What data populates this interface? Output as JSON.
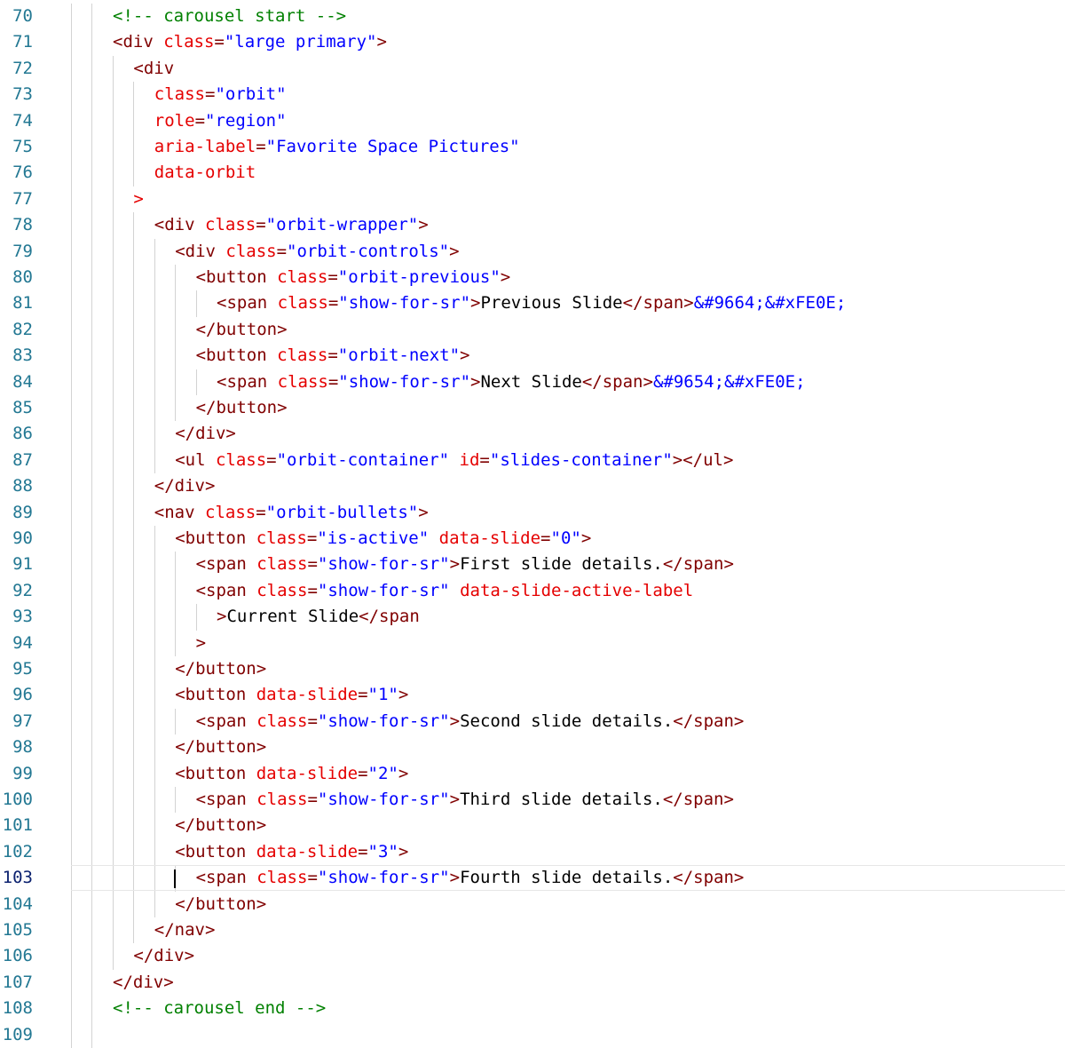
{
  "editor": {
    "language": "html",
    "current_line": 103,
    "colors": {
      "line_number": "#237893",
      "line_number_active": "#0b216f",
      "comment": "#008000",
      "tag": "#800000",
      "attribute": "#e50000",
      "string": "#0000ff",
      "text": "#000000",
      "indent_guide": "#d3d3d3"
    },
    "lines": [
      {
        "num": "70",
        "indent": 0,
        "tokens": [
          [
            "comment",
            "<!-- carousel start -->"
          ]
        ]
      },
      {
        "num": "71",
        "indent": 0,
        "tokens": [
          [
            "tag",
            "<div "
          ],
          [
            "attr",
            "class"
          ],
          [
            "tag",
            "="
          ],
          [
            "str",
            "\"large primary\""
          ],
          [
            "tag",
            ">"
          ]
        ]
      },
      {
        "num": "72",
        "indent": 1,
        "tokens": [
          [
            "tag",
            "<div"
          ]
        ]
      },
      {
        "num": "73",
        "indent": 2,
        "tokens": [
          [
            "attr",
            "class"
          ],
          [
            "tag",
            "="
          ],
          [
            "str",
            "\"orbit\""
          ]
        ]
      },
      {
        "num": "74",
        "indent": 2,
        "tokens": [
          [
            "attr",
            "role"
          ],
          [
            "tag",
            "="
          ],
          [
            "str",
            "\"region\""
          ]
        ]
      },
      {
        "num": "75",
        "indent": 2,
        "tokens": [
          [
            "attr",
            "aria-label"
          ],
          [
            "tag",
            "="
          ],
          [
            "str",
            "\"Favorite Space Pictures\""
          ]
        ]
      },
      {
        "num": "76",
        "indent": 2,
        "tokens": [
          [
            "attr",
            "data-orbit"
          ]
        ]
      },
      {
        "num": "77",
        "indent": 1,
        "tokens": [
          [
            "attr",
            ">"
          ]
        ]
      },
      {
        "num": "78",
        "indent": 2,
        "tokens": [
          [
            "tag",
            "<div "
          ],
          [
            "attr",
            "class"
          ],
          [
            "tag",
            "="
          ],
          [
            "str",
            "\"orbit-wrapper\""
          ],
          [
            "tag",
            ">"
          ]
        ]
      },
      {
        "num": "79",
        "indent": 3,
        "tokens": [
          [
            "tag",
            "<div "
          ],
          [
            "attr",
            "class"
          ],
          [
            "tag",
            "="
          ],
          [
            "str",
            "\"orbit-controls\""
          ],
          [
            "tag",
            ">"
          ]
        ]
      },
      {
        "num": "80",
        "indent": 4,
        "tokens": [
          [
            "tag",
            "<button "
          ],
          [
            "attr",
            "class"
          ],
          [
            "tag",
            "="
          ],
          [
            "str",
            "\"orbit-previous\""
          ],
          [
            "tag",
            ">"
          ]
        ]
      },
      {
        "num": "81",
        "indent": 5,
        "tokens": [
          [
            "tag",
            "<span "
          ],
          [
            "attr",
            "class"
          ],
          [
            "tag",
            "="
          ],
          [
            "str",
            "\"show-for-sr\""
          ],
          [
            "tag",
            ">"
          ],
          [
            "text",
            "Previous Slide"
          ],
          [
            "tag",
            "</span>"
          ],
          [
            "ent",
            "&#9664;&#xFE0E;"
          ]
        ]
      },
      {
        "num": "82",
        "indent": 4,
        "tokens": [
          [
            "tag",
            "</button>"
          ]
        ]
      },
      {
        "num": "83",
        "indent": 4,
        "tokens": [
          [
            "tag",
            "<button "
          ],
          [
            "attr",
            "class"
          ],
          [
            "tag",
            "="
          ],
          [
            "str",
            "\"orbit-next\""
          ],
          [
            "tag",
            ">"
          ]
        ]
      },
      {
        "num": "84",
        "indent": 5,
        "tokens": [
          [
            "tag",
            "<span "
          ],
          [
            "attr",
            "class"
          ],
          [
            "tag",
            "="
          ],
          [
            "str",
            "\"show-for-sr\""
          ],
          [
            "tag",
            ">"
          ],
          [
            "text",
            "Next Slide"
          ],
          [
            "tag",
            "</span>"
          ],
          [
            "ent",
            "&#9654;&#xFE0E;"
          ]
        ]
      },
      {
        "num": "85",
        "indent": 4,
        "tokens": [
          [
            "tag",
            "</button>"
          ]
        ]
      },
      {
        "num": "86",
        "indent": 3,
        "tokens": [
          [
            "tag",
            "</div>"
          ]
        ]
      },
      {
        "num": "87",
        "indent": 3,
        "tokens": [
          [
            "tag",
            "<ul "
          ],
          [
            "attr",
            "class"
          ],
          [
            "tag",
            "="
          ],
          [
            "str",
            "\"orbit-container\""
          ],
          [
            "text",
            " "
          ],
          [
            "attr",
            "id"
          ],
          [
            "tag",
            "="
          ],
          [
            "str",
            "\"slides-container\""
          ],
          [
            "tag",
            "></ul>"
          ]
        ]
      },
      {
        "num": "88",
        "indent": 2,
        "tokens": [
          [
            "tag",
            "</div>"
          ]
        ]
      },
      {
        "num": "89",
        "indent": 2,
        "tokens": [
          [
            "tag",
            "<nav "
          ],
          [
            "attr",
            "class"
          ],
          [
            "tag",
            "="
          ],
          [
            "str",
            "\"orbit-bullets\""
          ],
          [
            "tag",
            ">"
          ]
        ]
      },
      {
        "num": "90",
        "indent": 3,
        "tokens": [
          [
            "tag",
            "<button "
          ],
          [
            "attr",
            "class"
          ],
          [
            "tag",
            "="
          ],
          [
            "str",
            "\"is-active\""
          ],
          [
            "text",
            " "
          ],
          [
            "attr",
            "data-slide"
          ],
          [
            "tag",
            "="
          ],
          [
            "str",
            "\"0\""
          ],
          [
            "tag",
            ">"
          ]
        ]
      },
      {
        "num": "91",
        "indent": 4,
        "tokens": [
          [
            "tag",
            "<span "
          ],
          [
            "attr",
            "class"
          ],
          [
            "tag",
            "="
          ],
          [
            "str",
            "\"show-for-sr\""
          ],
          [
            "tag",
            ">"
          ],
          [
            "text",
            "First slide details."
          ],
          [
            "tag",
            "</span>"
          ]
        ]
      },
      {
        "num": "92",
        "indent": 4,
        "tokens": [
          [
            "tag",
            "<span "
          ],
          [
            "attr",
            "class"
          ],
          [
            "tag",
            "="
          ],
          [
            "str",
            "\"show-for-sr\""
          ],
          [
            "text",
            " "
          ],
          [
            "attr",
            "data-slide-active-label"
          ]
        ]
      },
      {
        "num": "93",
        "indent": 5,
        "tokens": [
          [
            "tag",
            ">"
          ],
          [
            "text",
            "Current Slide"
          ],
          [
            "tag",
            "</span"
          ]
        ]
      },
      {
        "num": "94",
        "indent": 4,
        "tokens": [
          [
            "tag",
            ">"
          ]
        ]
      },
      {
        "num": "95",
        "indent": 3,
        "tokens": [
          [
            "tag",
            "</button>"
          ]
        ]
      },
      {
        "num": "96",
        "indent": 3,
        "tokens": [
          [
            "tag",
            "<button "
          ],
          [
            "attr",
            "data-slide"
          ],
          [
            "tag",
            "="
          ],
          [
            "str",
            "\"1\""
          ],
          [
            "tag",
            ">"
          ]
        ]
      },
      {
        "num": "97",
        "indent": 4,
        "tokens": [
          [
            "tag",
            "<span "
          ],
          [
            "attr",
            "class"
          ],
          [
            "tag",
            "="
          ],
          [
            "str",
            "\"show-for-sr\""
          ],
          [
            "tag",
            ">"
          ],
          [
            "text",
            "Second slide details."
          ],
          [
            "tag",
            "</span>"
          ]
        ]
      },
      {
        "num": "98",
        "indent": 3,
        "tokens": [
          [
            "tag",
            "</button>"
          ]
        ]
      },
      {
        "num": "99",
        "indent": 3,
        "tokens": [
          [
            "tag",
            "<button "
          ],
          [
            "attr",
            "data-slide"
          ],
          [
            "tag",
            "="
          ],
          [
            "str",
            "\"2\""
          ],
          [
            "tag",
            ">"
          ]
        ]
      },
      {
        "num": "100",
        "indent": 4,
        "tokens": [
          [
            "tag",
            "<span "
          ],
          [
            "attr",
            "class"
          ],
          [
            "tag",
            "="
          ],
          [
            "str",
            "\"show-for-sr\""
          ],
          [
            "tag",
            ">"
          ],
          [
            "text",
            "Third slide details."
          ],
          [
            "tag",
            "</span>"
          ]
        ]
      },
      {
        "num": "101",
        "indent": 3,
        "tokens": [
          [
            "tag",
            "</button>"
          ]
        ]
      },
      {
        "num": "102",
        "indent": 3,
        "tokens": [
          [
            "tag",
            "<button "
          ],
          [
            "attr",
            "data-slide"
          ],
          [
            "tag",
            "="
          ],
          [
            "str",
            "\"3\""
          ],
          [
            "tag",
            ">"
          ]
        ]
      },
      {
        "num": "103",
        "indent": 4,
        "tokens": [
          [
            "tag",
            "<span "
          ],
          [
            "attr",
            "class"
          ],
          [
            "tag",
            "="
          ],
          [
            "str",
            "\"show-for-sr\""
          ],
          [
            "tag",
            ">"
          ],
          [
            "text",
            "Fourth slide details."
          ],
          [
            "tag",
            "</span>"
          ]
        ]
      },
      {
        "num": "104",
        "indent": 3,
        "tokens": [
          [
            "tag",
            "</button>"
          ]
        ]
      },
      {
        "num": "105",
        "indent": 2,
        "tokens": [
          [
            "tag",
            "</nav>"
          ]
        ]
      },
      {
        "num": "106",
        "indent": 1,
        "tokens": [
          [
            "tag",
            "</div>"
          ]
        ]
      },
      {
        "num": "107",
        "indent": 0,
        "tokens": [
          [
            "tag",
            "</div>"
          ]
        ]
      },
      {
        "num": "108",
        "indent": 0,
        "tokens": [
          [
            "comment",
            "<!-- carousel end -->"
          ]
        ]
      },
      {
        "num": "109",
        "indent": 0,
        "tokens": []
      }
    ]
  }
}
